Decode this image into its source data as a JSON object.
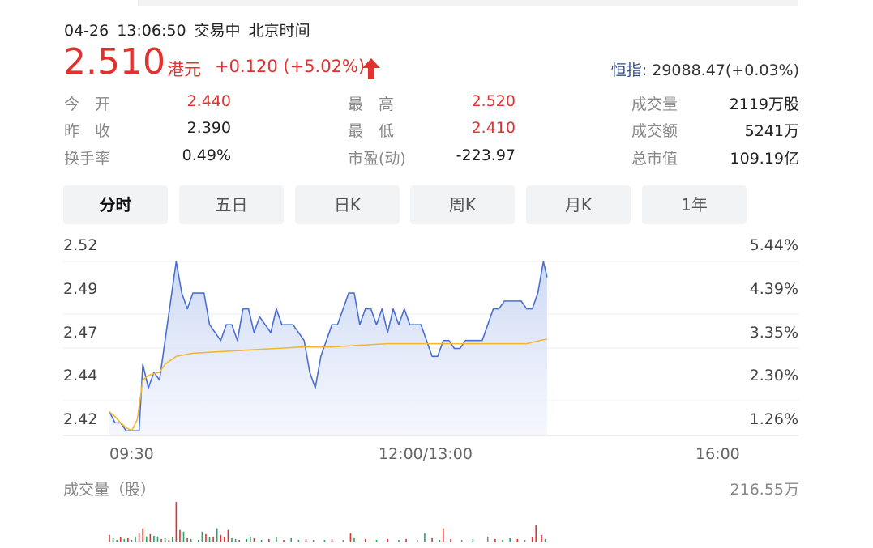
{
  "header": {
    "date": "04-26",
    "time": "13:06:50",
    "status": "交易中",
    "timezone": "北京时间"
  },
  "quote": {
    "price": "2.510",
    "currency": "港元",
    "change": "+0.120 (+5.02%)",
    "direction_icon": "arrow-up-icon",
    "up_color": "#e0332f"
  },
  "index": {
    "label": "恒指",
    "value": ": 29088.47(+0.03%)"
  },
  "stats": [
    {
      "label": "今　开",
      "value": "2.440",
      "red": true
    },
    {
      "label": "最　高",
      "value": "2.520",
      "red": true
    },
    {
      "label": "成交量",
      "value": "2119万股",
      "red": false
    },
    {
      "label": "昨　收",
      "value": "2.390",
      "red": false
    },
    {
      "label": "最　低",
      "value": "2.410",
      "red": true
    },
    {
      "label": "成交额",
      "value": "5241万",
      "red": false
    },
    {
      "label": "换手率",
      "value": "0.49%",
      "red": false
    },
    {
      "label": "市盈(动)",
      "value": "-223.97",
      "red": false
    },
    {
      "label": "总市值",
      "value": "109.19亿",
      "red": false
    }
  ],
  "tabs": [
    "分时",
    "五日",
    "日K",
    "周K",
    "月K",
    "1年"
  ],
  "active_tab": "分时",
  "chart_data": {
    "type": "line",
    "y_ticks": [
      "2.52",
      "2.49",
      "2.47",
      "2.44",
      "2.42"
    ],
    "right_ticks": [
      "5.44%",
      "4.39%",
      "3.35%",
      "2.30%",
      "1.26%"
    ],
    "x_ticks": [
      "09:30",
      "12:00/13:00",
      "16:00"
    ],
    "ylim": [
      2.41,
      2.52
    ],
    "x_range_minutes": [
      0,
      330
    ],
    "series": [
      {
        "color": "#4a6fd4",
        "x": [
          0,
          3,
          6,
          9,
          12,
          16,
          18,
          21,
          24,
          27,
          30,
          33,
          36,
          39,
          42,
          45,
          48,
          51,
          54,
          57,
          60,
          63,
          66,
          69,
          72,
          75,
          78,
          81,
          84,
          87,
          90,
          93,
          96,
          99,
          102,
          105,
          108,
          111,
          114,
          117,
          120,
          123,
          126,
          129,
          132,
          135,
          138,
          141,
          144,
          147,
          150,
          153,
          156,
          159,
          162,
          165,
          168,
          171,
          174,
          177,
          180,
          183,
          186,
          189,
          192,
          195,
          198,
          201,
          204,
          207,
          210,
          213,
          216,
          219,
          222,
          225,
          228,
          231,
          234,
          236
        ],
        "y": [
          2.425,
          2.418,
          2.418,
          2.413,
          2.413,
          2.413,
          2.455,
          2.44,
          2.45,
          2.445,
          2.47,
          2.495,
          2.52,
          2.5,
          2.49,
          2.5,
          2.5,
          2.5,
          2.48,
          2.475,
          2.47,
          2.48,
          2.48,
          2.47,
          2.49,
          2.49,
          2.475,
          2.485,
          2.48,
          2.475,
          2.49,
          2.48,
          2.48,
          2.48,
          2.475,
          2.47,
          2.45,
          2.44,
          2.46,
          2.47,
          2.48,
          2.48,
          2.49,
          2.5,
          2.5,
          2.48,
          2.49,
          2.49,
          2.48,
          2.49,
          2.475,
          2.49,
          2.48,
          2.49,
          2.48,
          2.48,
          2.48,
          2.47,
          2.46,
          2.46,
          2.47,
          2.47,
          2.465,
          2.465,
          2.47,
          2.47,
          2.47,
          2.47,
          2.48,
          2.49,
          2.49,
          2.495,
          2.495,
          2.495,
          2.495,
          2.49,
          2.49,
          2.5,
          2.52,
          2.51
        ]
      },
      {
        "color": "#f2b731",
        "x": [
          0,
          3,
          6,
          9,
          12,
          15,
          18,
          21,
          24,
          27,
          30,
          36,
          45,
          60,
          75,
          90,
          105,
          120,
          135,
          150,
          165,
          180,
          195,
          210,
          225,
          232,
          236
        ],
        "y": [
          2.425,
          2.422,
          2.418,
          2.415,
          2.413,
          2.42,
          2.445,
          2.448,
          2.449,
          2.45,
          2.455,
          2.46,
          2.462,
          2.463,
          2.464,
          2.465,
          2.466,
          2.466,
          2.467,
          2.468,
          2.468,
          2.468,
          2.468,
          2.468,
          2.468,
          2.47,
          2.471
        ]
      }
    ]
  },
  "volume": {
    "title": "成交量（股）",
    "max_label": "216.55万",
    "up_color": "#e0332f",
    "down_color": "#27a35f",
    "flat_color": "#888888",
    "bars": [
      {
        "x": 0,
        "v": 8,
        "c": "u"
      },
      {
        "x": 2,
        "v": 4,
        "c": "d"
      },
      {
        "x": 4,
        "v": 2,
        "c": "d"
      },
      {
        "x": 6,
        "v": 5,
        "c": "u"
      },
      {
        "x": 8,
        "v": 3,
        "c": "d"
      },
      {
        "x": 10,
        "v": 4,
        "c": "u"
      },
      {
        "x": 12,
        "v": 2,
        "c": "d"
      },
      {
        "x": 14,
        "v": 6,
        "c": "d"
      },
      {
        "x": 16,
        "v": 10,
        "c": "u"
      },
      {
        "x": 18,
        "v": 16,
        "c": "u"
      },
      {
        "x": 20,
        "v": 6,
        "c": "d"
      },
      {
        "x": 22,
        "v": 9,
        "c": "u"
      },
      {
        "x": 24,
        "v": 7,
        "c": "d"
      },
      {
        "x": 26,
        "v": 6,
        "c": "d"
      },
      {
        "x": 28,
        "v": 3,
        "c": "u"
      },
      {
        "x": 30,
        "v": 4,
        "c": "d"
      },
      {
        "x": 32,
        "v": 2,
        "c": "u"
      },
      {
        "x": 34,
        "v": 5,
        "c": "d"
      },
      {
        "x": 36,
        "v": 48,
        "c": "u"
      },
      {
        "x": 38,
        "v": 14,
        "c": "u"
      },
      {
        "x": 40,
        "v": 12,
        "c": "d"
      },
      {
        "x": 42,
        "v": 4,
        "c": "u"
      },
      {
        "x": 44,
        "v": 3,
        "c": "d"
      },
      {
        "x": 48,
        "v": 2,
        "c": "d"
      },
      {
        "x": 50,
        "v": 12,
        "c": "d"
      },
      {
        "x": 52,
        "v": 9,
        "c": "u"
      },
      {
        "x": 54,
        "v": 5,
        "c": "d"
      },
      {
        "x": 56,
        "v": 6,
        "c": "u"
      },
      {
        "x": 58,
        "v": 16,
        "c": "d"
      },
      {
        "x": 60,
        "v": 8,
        "c": "u"
      },
      {
        "x": 62,
        "v": 5,
        "c": "u"
      },
      {
        "x": 64,
        "v": 14,
        "c": "u"
      },
      {
        "x": 66,
        "v": 4,
        "c": "d"
      },
      {
        "x": 68,
        "v": 3,
        "c": "d"
      },
      {
        "x": 70,
        "v": 2,
        "c": "u"
      },
      {
        "x": 74,
        "v": 3,
        "c": "d"
      },
      {
        "x": 76,
        "v": 6,
        "c": "d"
      },
      {
        "x": 78,
        "v": 4,
        "c": "u"
      },
      {
        "x": 82,
        "v": 2,
        "c": "d"
      },
      {
        "x": 86,
        "v": 3,
        "c": "u"
      },
      {
        "x": 90,
        "v": 5,
        "c": "d"
      },
      {
        "x": 94,
        "v": 2,
        "c": "u"
      },
      {
        "x": 98,
        "v": 4,
        "c": "d"
      },
      {
        "x": 102,
        "v": 2,
        "c": "d"
      },
      {
        "x": 106,
        "v": 3,
        "c": "u"
      },
      {
        "x": 110,
        "v": 2,
        "c": "f"
      },
      {
        "x": 116,
        "v": 2,
        "c": "d"
      },
      {
        "x": 120,
        "v": 3,
        "c": "u"
      },
      {
        "x": 126,
        "v": 2,
        "c": "f"
      },
      {
        "x": 130,
        "v": 10,
        "c": "u"
      },
      {
        "x": 132,
        "v": 4,
        "c": "d"
      },
      {
        "x": 138,
        "v": 3,
        "c": "u"
      },
      {
        "x": 144,
        "v": 2,
        "c": "d"
      },
      {
        "x": 150,
        "v": 3,
        "c": "u"
      },
      {
        "x": 156,
        "v": 2,
        "c": "d"
      },
      {
        "x": 160,
        "v": 3,
        "c": "u"
      },
      {
        "x": 166,
        "v": 2,
        "c": "f"
      },
      {
        "x": 170,
        "v": 10,
        "c": "d"
      },
      {
        "x": 174,
        "v": 4,
        "c": "u"
      },
      {
        "x": 178,
        "v": 2,
        "c": "d"
      },
      {
        "x": 180,
        "v": 16,
        "c": "u"
      },
      {
        "x": 184,
        "v": 3,
        "c": "u"
      },
      {
        "x": 190,
        "v": 2,
        "c": "f"
      },
      {
        "x": 196,
        "v": 3,
        "c": "d"
      },
      {
        "x": 204,
        "v": 6,
        "c": "f"
      },
      {
        "x": 208,
        "v": 3,
        "c": "u"
      },
      {
        "x": 212,
        "v": 2,
        "c": "d"
      },
      {
        "x": 216,
        "v": 4,
        "c": "d"
      },
      {
        "x": 220,
        "v": 3,
        "c": "u"
      },
      {
        "x": 224,
        "v": 2,
        "c": "d"
      },
      {
        "x": 228,
        "v": 5,
        "c": "u"
      },
      {
        "x": 230,
        "v": 20,
        "c": "u"
      },
      {
        "x": 233,
        "v": 8,
        "c": "u"
      },
      {
        "x": 235,
        "v": 3,
        "c": "d"
      }
    ]
  }
}
